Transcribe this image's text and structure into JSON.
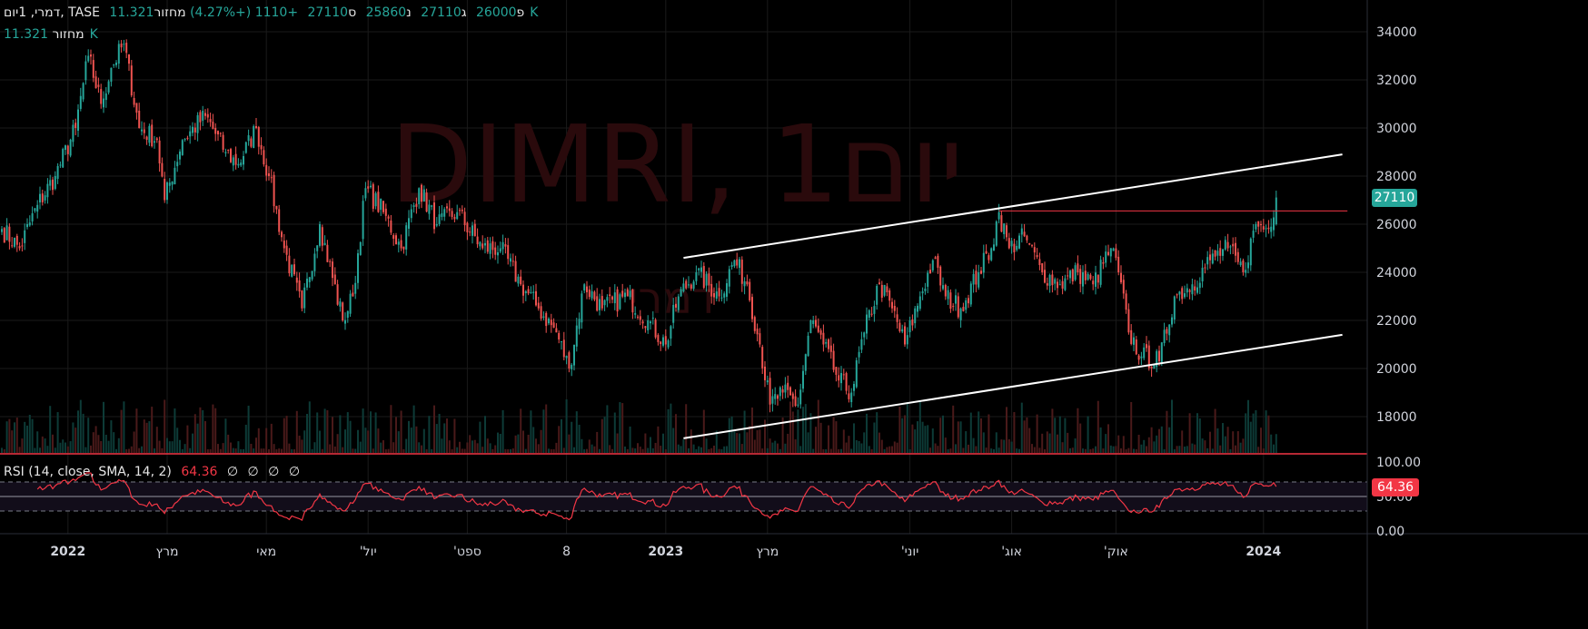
{
  "header": {
    "symbol_line": "דמרי, 1יום, TASE",
    "open_label": "פ",
    "open": "26000",
    "high_label": "ג",
    "high": "27110",
    "low_label": "נ",
    "low": "25860",
    "close_label": "ס",
    "close": "27110",
    "change": "+1110 (+4.27%)",
    "volume_label": "מחזור",
    "volume": "11.321K"
  },
  "volume_legend": {
    "label": "מחזור",
    "value": "11.321K"
  },
  "rsi_legend": {
    "label": "RSI (14, close, SMA, 14, 2)",
    "value": "64.36",
    "extras": [
      "∅",
      "∅",
      "∅",
      "∅"
    ]
  },
  "watermark": {
    "title": "DIMRI, 1יום",
    "subtitle": "דמרי"
  },
  "last_price_tag": "27110",
  "rsi_tag": "64.36",
  "colors": {
    "up": "#26a69a",
    "down": "#ef5350",
    "rsi": "#f23645",
    "bg": "#000000"
  },
  "chart_data": {
    "type": "candlestick",
    "title": "DIMRI, 1D, TASE",
    "ylim": [
      17000,
      34500
    ],
    "yticks": [
      "34000",
      "32000",
      "30000",
      "28000",
      "26000",
      "24000",
      "22000",
      "20000",
      "18000"
    ],
    "rsi_ticks": [
      "100.00",
      "50.00",
      "0.00"
    ],
    "xticks": [
      {
        "bar": 26,
        "label": "2022"
      },
      {
        "bar": 65,
        "label": "מרץ"
      },
      {
        "bar": 104,
        "label": "מאי"
      },
      {
        "bar": 144,
        "label": "'יול"
      },
      {
        "bar": 183,
        "label": "'ספט"
      },
      {
        "bar": 222,
        "label": "8"
      },
      {
        "bar": 261,
        "label": "2023"
      },
      {
        "bar": 301,
        "label": "מרץ"
      },
      {
        "bar": 357,
        "label": "'יוני"
      },
      {
        "bar": 397,
        "label": "'אוג"
      },
      {
        "bar": 438,
        "label": "'אוק"
      },
      {
        "bar": 496,
        "label": "2024"
      }
    ],
    "close_path": [
      [
        0,
        25800
      ],
      [
        7,
        25000
      ],
      [
        14,
        26800
      ],
      [
        21,
        28000
      ],
      [
        29,
        30000
      ],
      [
        34,
        33000
      ],
      [
        39,
        31000
      ],
      [
        43,
        32500
      ],
      [
        48,
        33500
      ],
      [
        54,
        30000
      ],
      [
        61,
        29500
      ],
      [
        64,
        27000
      ],
      [
        71,
        29500
      ],
      [
        80,
        30500
      ],
      [
        88,
        29000
      ],
      [
        93,
        28500
      ],
      [
        100,
        30000
      ],
      [
        105,
        28000
      ],
      [
        111,
        25000
      ],
      [
        118,
        22500
      ],
      [
        125,
        26000
      ],
      [
        134,
        22000
      ],
      [
        138,
        23000
      ],
      [
        143,
        27500
      ],
      [
        150,
        26500
      ],
      [
        157,
        25000
      ],
      [
        164,
        27500
      ],
      [
        171,
        26000
      ],
      [
        179,
        26500
      ],
      [
        189,
        25000
      ],
      [
        196,
        25000
      ],
      [
        204,
        23500
      ],
      [
        211,
        22500
      ],
      [
        218,
        21500
      ],
      [
        223,
        20000
      ],
      [
        229,
        23500
      ],
      [
        236,
        22500
      ],
      [
        246,
        23000
      ],
      [
        254,
        22000
      ],
      [
        261,
        21000
      ],
      [
        266,
        23000
      ],
      [
        273,
        24000
      ],
      [
        282,
        23000
      ],
      [
        288,
        24500
      ],
      [
        293,
        23500
      ],
      [
        298,
        21000
      ],
      [
        302,
        18500
      ],
      [
        307,
        19000
      ],
      [
        313,
        18500
      ],
      [
        318,
        22000
      ],
      [
        323,
        21000
      ],
      [
        329,
        19500
      ],
      [
        334,
        19000
      ],
      [
        339,
        21500
      ],
      [
        345,
        23500
      ],
      [
        350,
        22500
      ],
      [
        355,
        21000
      ],
      [
        361,
        23000
      ],
      [
        366,
        24500
      ],
      [
        371,
        23000
      ],
      [
        377,
        22500
      ],
      [
        384,
        24000
      ],
      [
        389,
        25000
      ],
      [
        392,
        26500
      ],
      [
        396,
        25000
      ],
      [
        402,
        25500
      ],
      [
        409,
        24000
      ],
      [
        416,
        23500
      ],
      [
        423,
        24000
      ],
      [
        429,
        23500
      ],
      [
        436,
        25000
      ],
      [
        439,
        24000
      ],
      [
        443,
        21500
      ],
      [
        448,
        20500
      ],
      [
        455,
        20300
      ],
      [
        461,
        23000
      ],
      [
        468,
        23500
      ],
      [
        475,
        24500
      ],
      [
        482,
        25000
      ],
      [
        488,
        24000
      ],
      [
        493,
        26000
      ],
      [
        498,
        25800
      ],
      [
        501,
        27110
      ]
    ],
    "trendlines": [
      {
        "from": [
          268,
          24600
        ],
        "to": [
          527,
          28900
        ],
        "color": "#ffffff"
      },
      {
        "from": [
          268,
          17100
        ],
        "to": [
          527,
          21400
        ],
        "color": "#ffffff"
      },
      {
        "from": [
          392,
          26550
        ],
        "to": [
          529,
          26550
        ],
        "color": "#f23645"
      }
    ],
    "rsi_last": 64.36,
    "rsi_bands": [
      70,
      50,
      30
    ]
  }
}
